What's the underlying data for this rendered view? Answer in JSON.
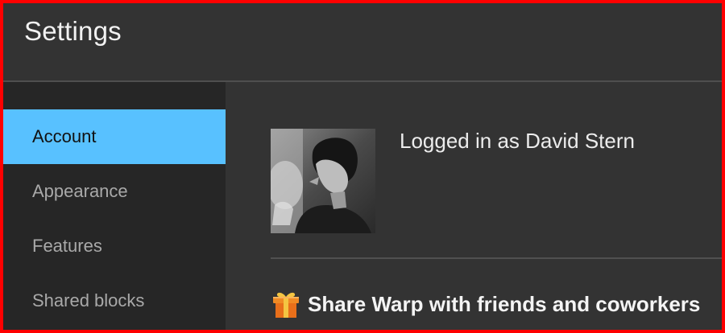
{
  "header": {
    "title": "Settings"
  },
  "sidebar": {
    "items": [
      {
        "label": "Account",
        "active": true
      },
      {
        "label": "Appearance",
        "active": false
      },
      {
        "label": "Features",
        "active": false
      },
      {
        "label": "Shared blocks",
        "active": false
      }
    ]
  },
  "account": {
    "avatar_icon": "user-photo",
    "logged_in_text": "Logged in as David Stern",
    "share_icon": "gift-icon",
    "share_label": "Share Warp with friends and coworkers"
  },
  "colors": {
    "accent": "#58c1ff",
    "window_border": "#ff0000",
    "background": "#333333",
    "sidebar": "#262626"
  }
}
